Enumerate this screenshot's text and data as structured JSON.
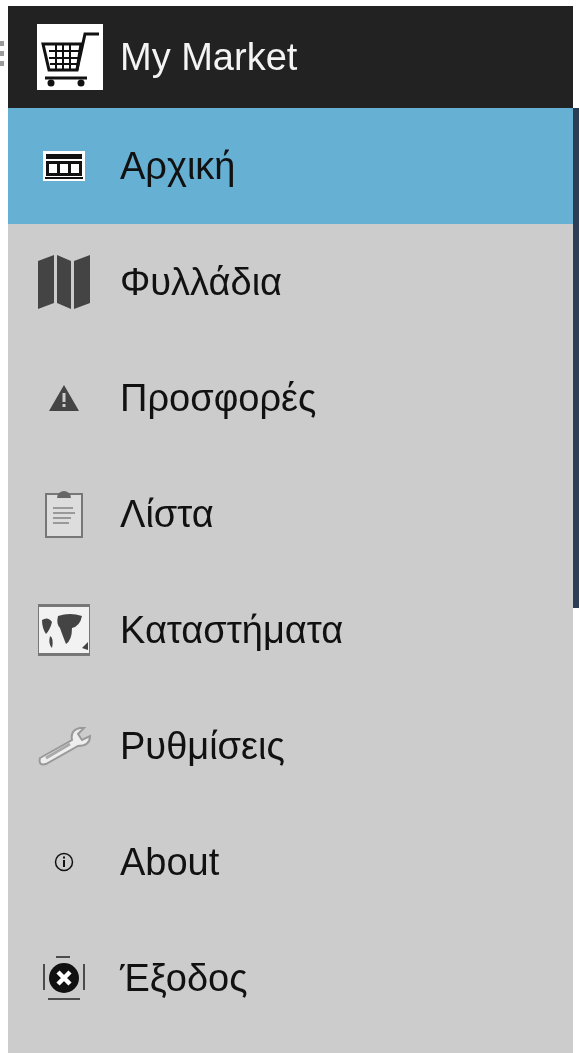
{
  "header": {
    "title": "My Market"
  },
  "menu": [
    {
      "label": "Αρχική",
      "kind": "store",
      "selected": true
    },
    {
      "label": "Φυλλάδια",
      "kind": "map",
      "selected": false
    },
    {
      "label": "Προσφορές",
      "kind": "warning",
      "selected": false
    },
    {
      "label": "Λίστα",
      "kind": "clipboard",
      "selected": false
    },
    {
      "label": "Καταστήματα",
      "kind": "world",
      "selected": false
    },
    {
      "label": "Ρυθμίσεις",
      "kind": "wrench",
      "selected": false
    },
    {
      "label": "About",
      "kind": "info",
      "selected": false
    },
    {
      "label": "Έξοδος",
      "kind": "close",
      "selected": false
    }
  ]
}
